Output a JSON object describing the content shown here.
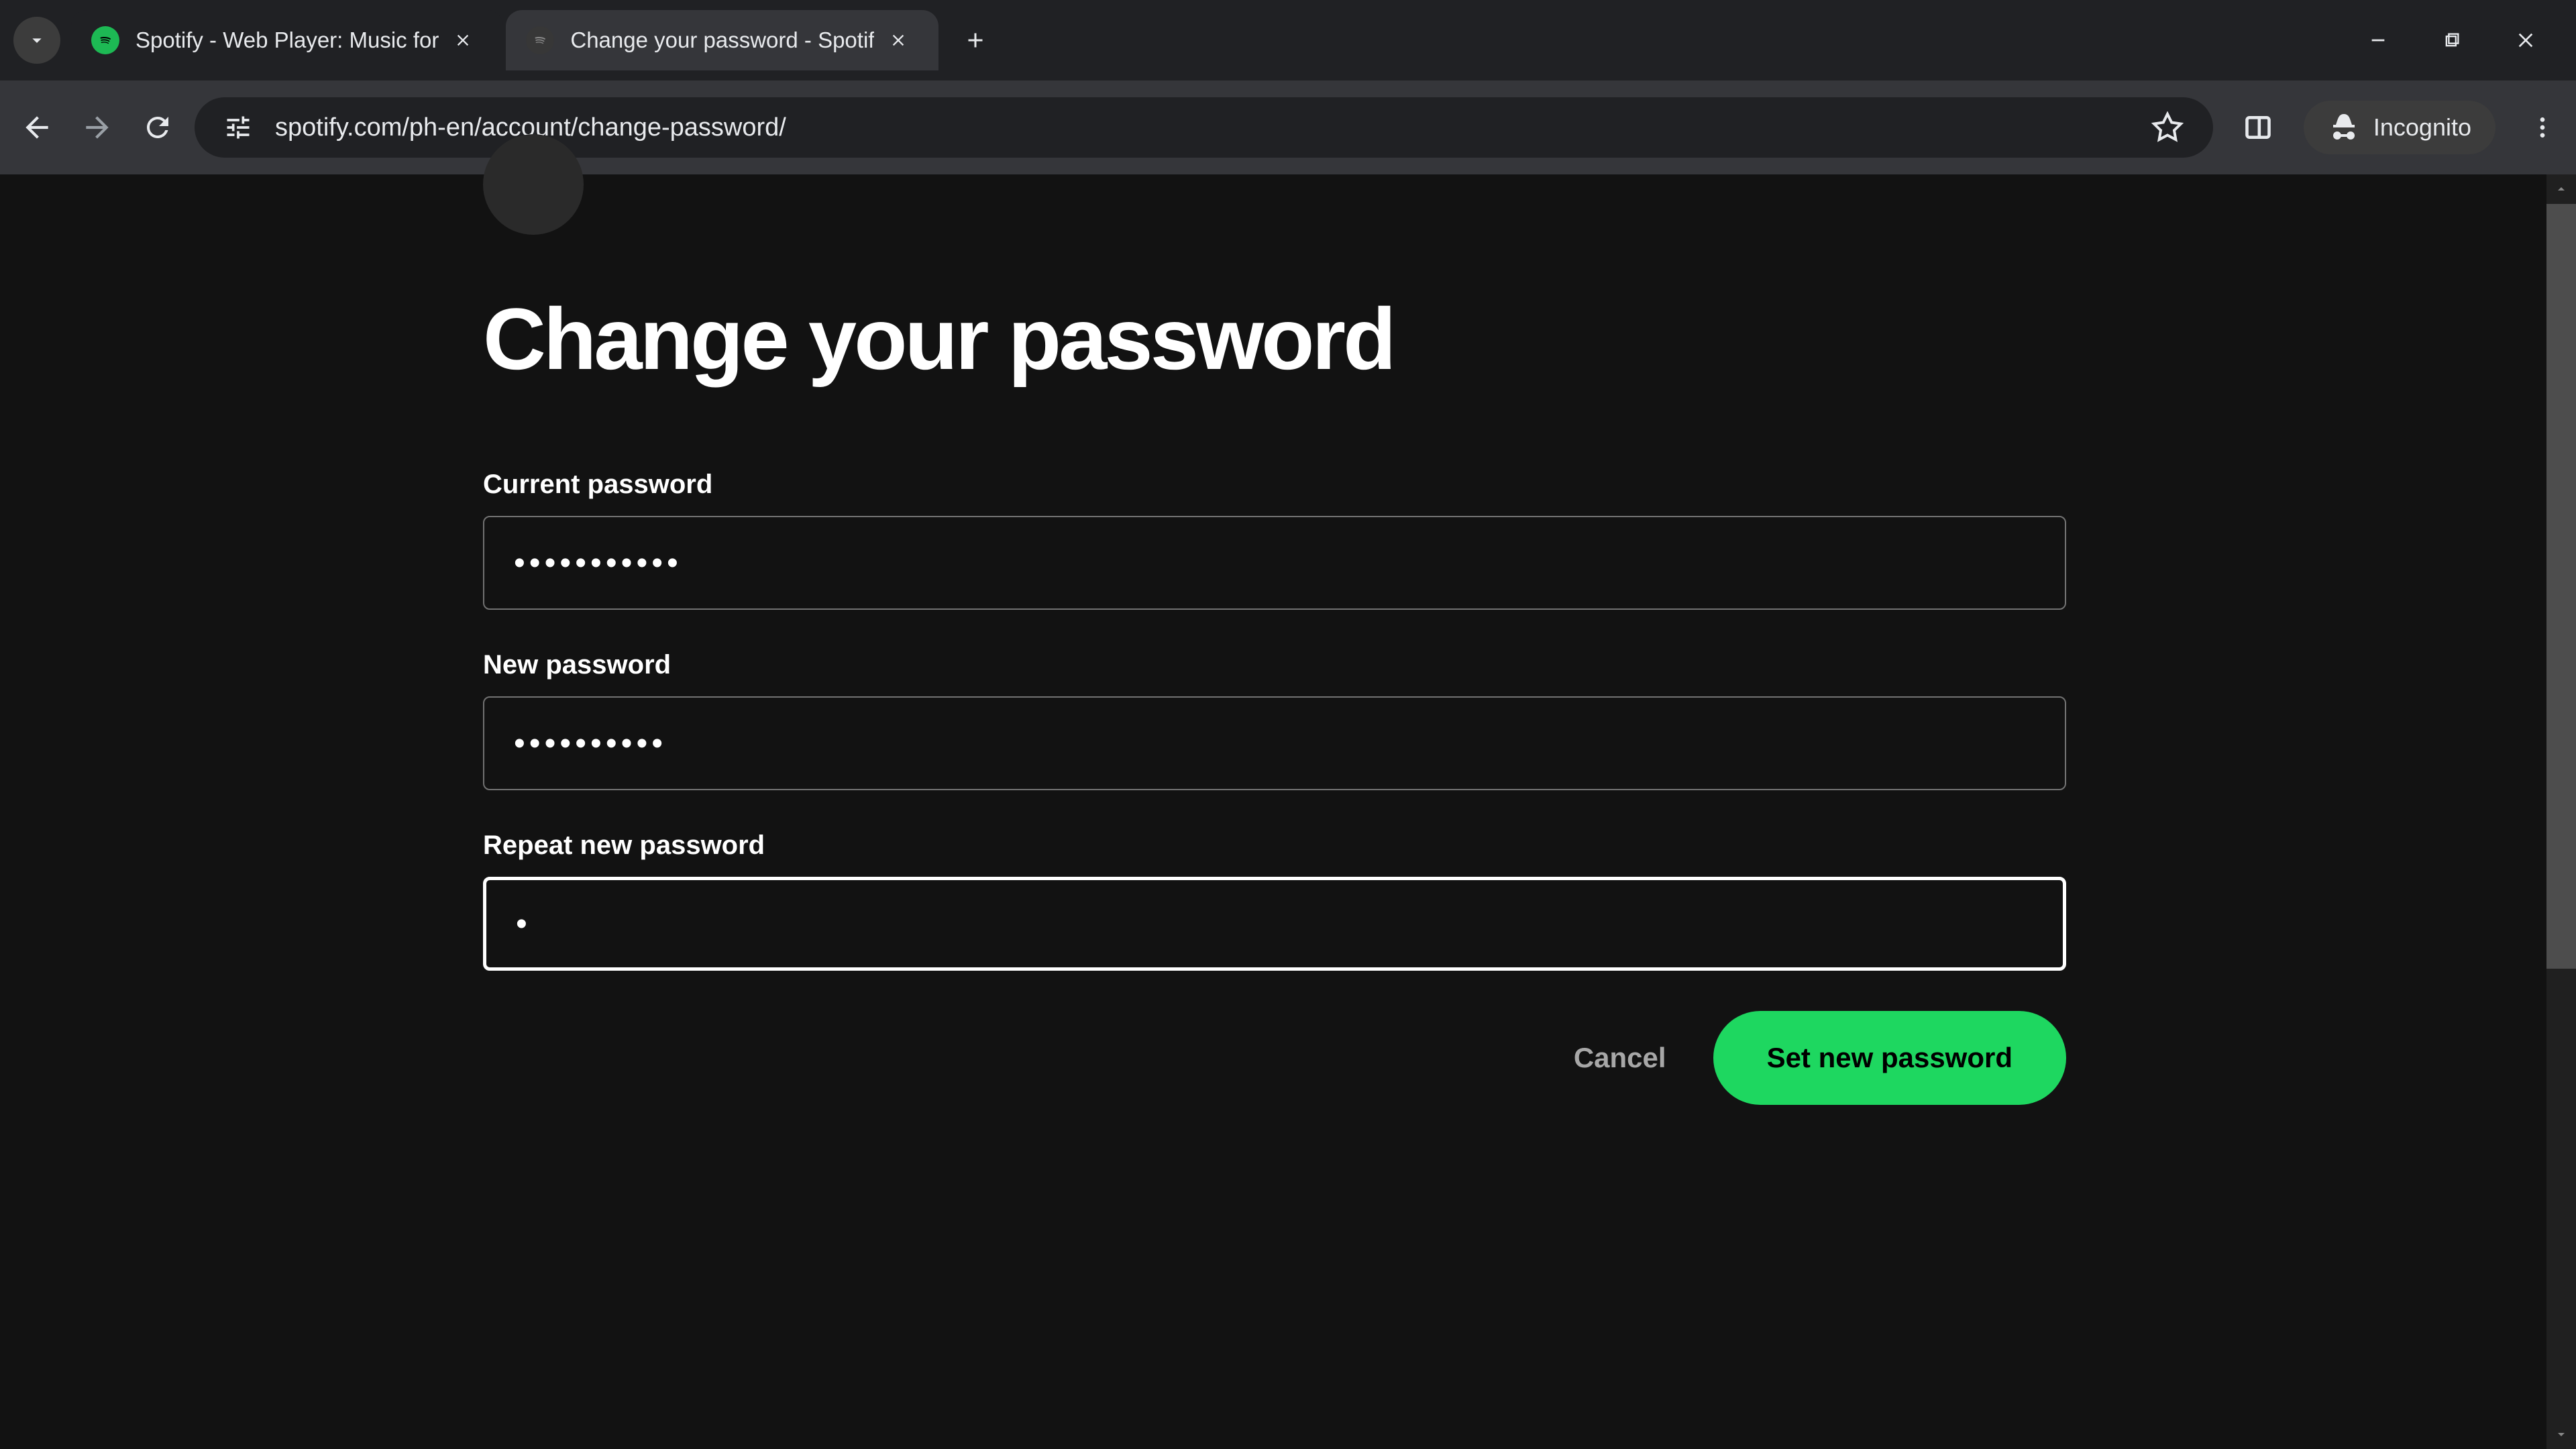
{
  "browser": {
    "tabs": [
      {
        "title": "Spotify - Web Player: Music for",
        "active": false
      },
      {
        "title": "Change your password - Spotif",
        "active": true
      }
    ],
    "url": "spotify.com/ph-en/account/change-password/",
    "incognito_label": "Incognito"
  },
  "page": {
    "heading": "Change your password",
    "labels": {
      "current": "Current password",
      "new": "New password",
      "repeat": "Repeat new password"
    },
    "values": {
      "current": "•••••••••••",
      "new": "••••••••••",
      "repeat": "•"
    },
    "buttons": {
      "cancel": "Cancel",
      "submit": "Set new password"
    }
  }
}
